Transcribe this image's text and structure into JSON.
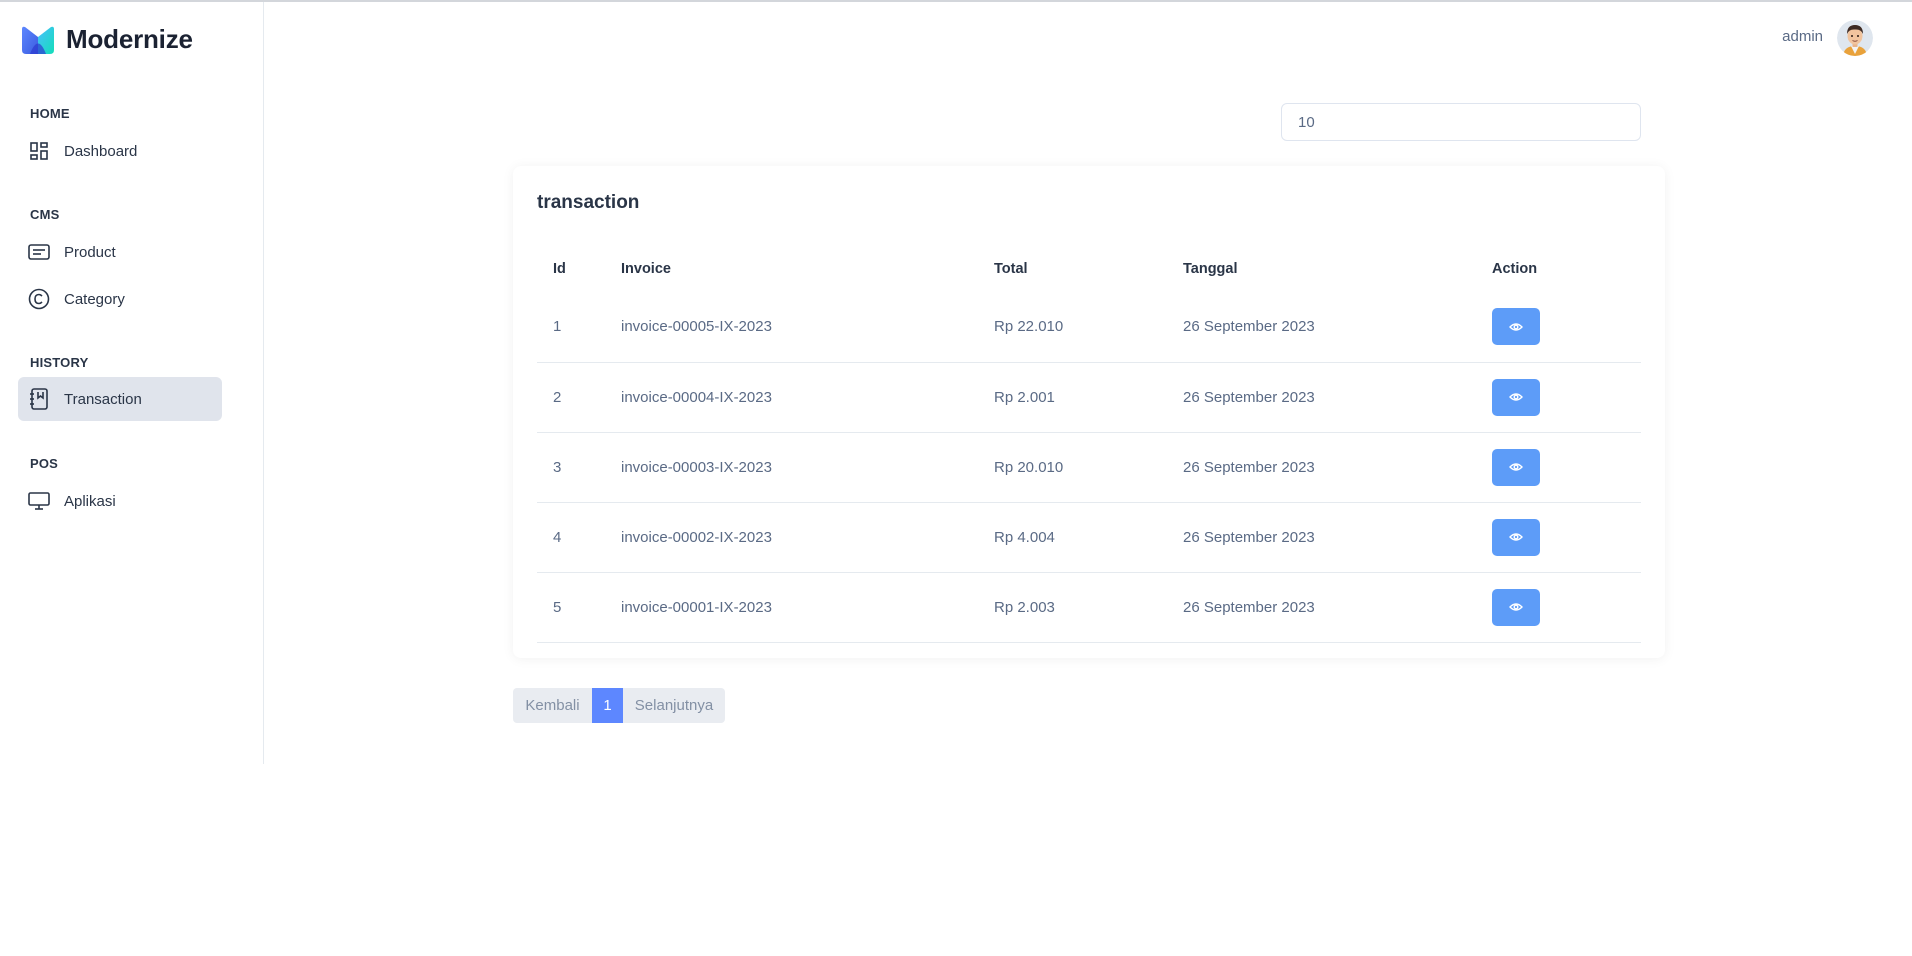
{
  "app": {
    "brand_name": "Modernize"
  },
  "sidebar": {
    "sections": [
      {
        "title": "HOME",
        "items": [
          {
            "label": "Dashboard",
            "icon": "dashboard-icon"
          }
        ]
      },
      {
        "title": "CMS",
        "items": [
          {
            "label": "Product",
            "icon": "product-icon"
          },
          {
            "label": "Category",
            "icon": "category-icon"
          }
        ]
      },
      {
        "title": "HISTORY",
        "items": [
          {
            "label": "Transaction",
            "icon": "transaction-icon",
            "active": true
          }
        ]
      },
      {
        "title": "POS",
        "items": [
          {
            "label": "Aplikasi",
            "icon": "monitor-icon"
          }
        ]
      }
    ]
  },
  "header": {
    "user_name": "admin"
  },
  "search": {
    "value": "10"
  },
  "card": {
    "title": "transaction",
    "columns": [
      "Id",
      "Invoice",
      "Total",
      "Tanggal",
      "Action"
    ],
    "rows": [
      {
        "id": "1",
        "invoice": "invoice-00005-IX-2023",
        "total": "Rp 22.010",
        "date": "26 September 2023"
      },
      {
        "id": "2",
        "invoice": "invoice-00004-IX-2023",
        "total": "Rp 2.001",
        "date": "26 September 2023"
      },
      {
        "id": "3",
        "invoice": "invoice-00003-IX-2023",
        "total": "Rp 20.010",
        "date": "26 September 2023"
      },
      {
        "id": "4",
        "invoice": "invoice-00002-IX-2023",
        "total": "Rp 4.004",
        "date": "26 September 2023"
      },
      {
        "id": "5",
        "invoice": "invoice-00001-IX-2023",
        "total": "Rp 2.003",
        "date": "26 September 2023"
      }
    ]
  },
  "pagination": {
    "prev_label": "Kembali",
    "current_page": "1",
    "next_label": "Selanjutnya"
  },
  "colors": {
    "accent": "#5d87ff",
    "action_button": "#5d9cf8",
    "active_nav_bg": "#e0e4ec"
  }
}
